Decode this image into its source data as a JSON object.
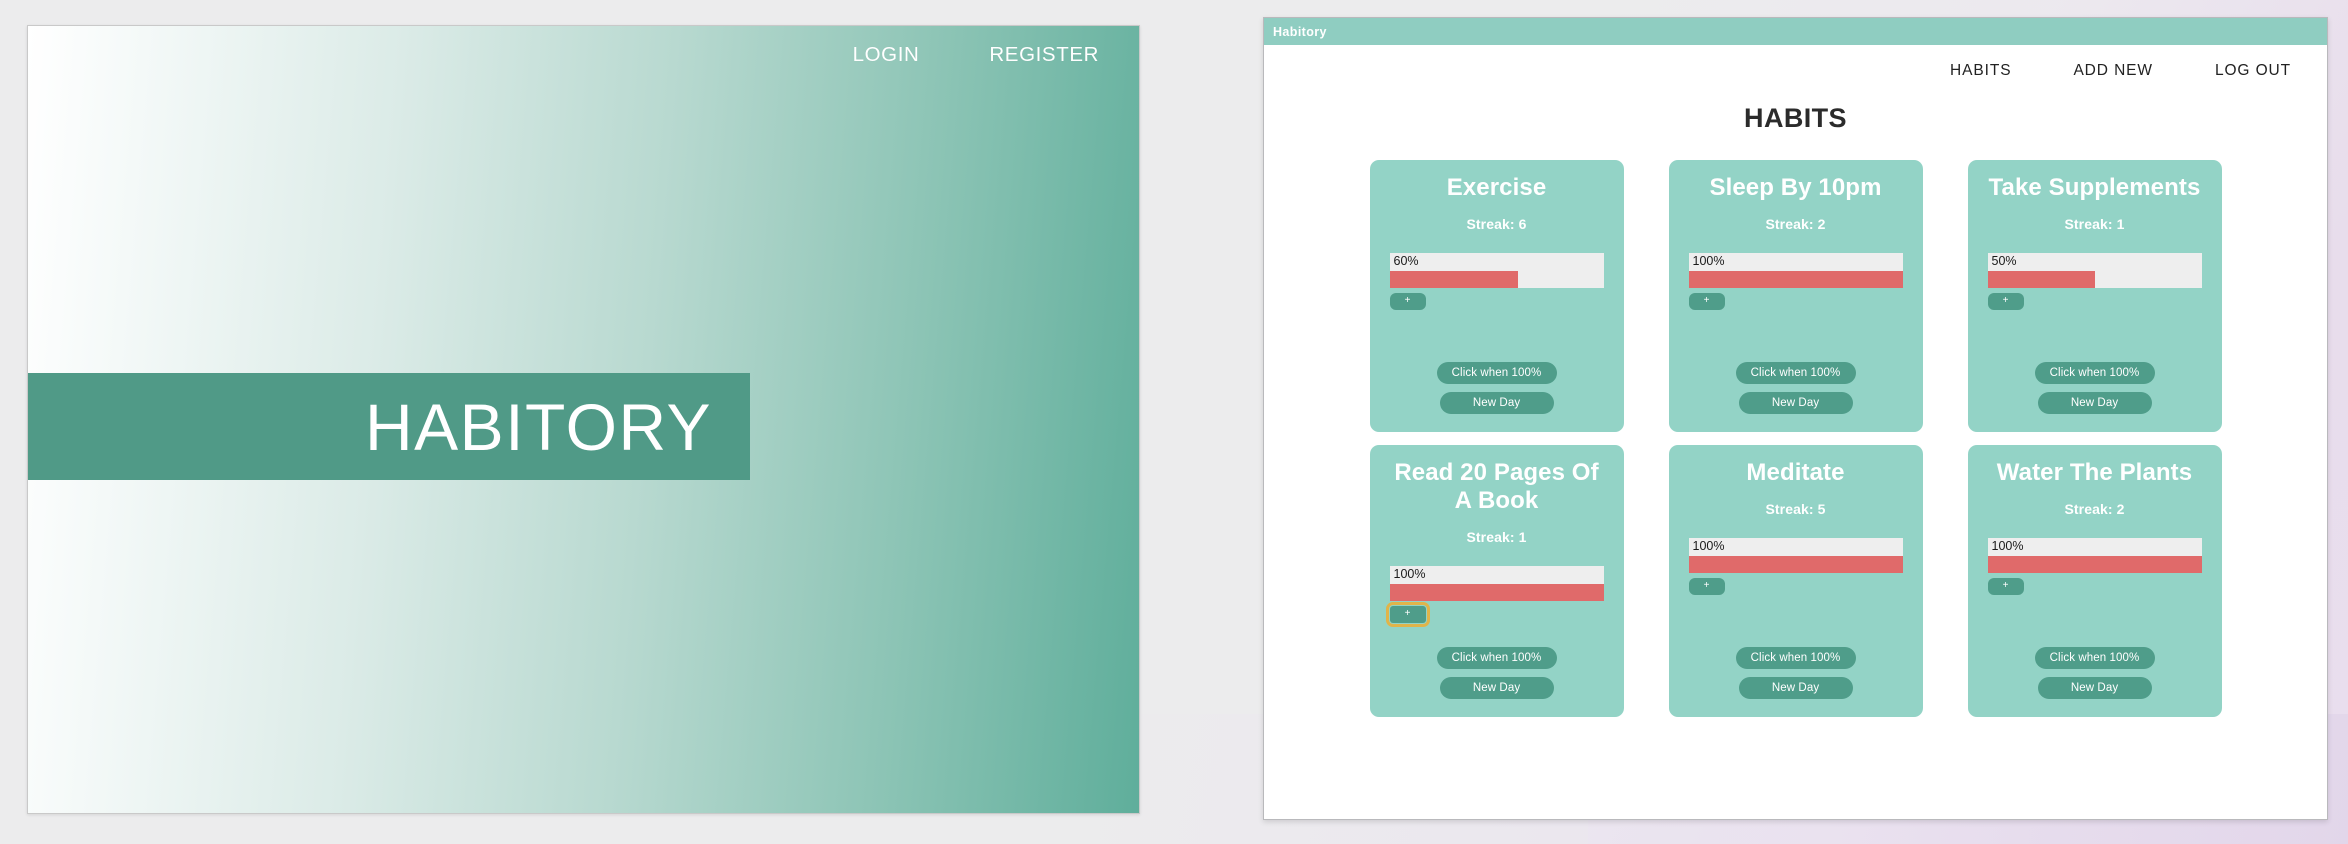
{
  "desktop": {
    "background_color": "#ececed",
    "accent_lavender": "#e8dcec"
  },
  "left_window": {
    "name": "habitory-landing-page",
    "gradient_from": "#ffffff",
    "gradient_to": "#5fae9b",
    "nav": [
      {
        "label": "LOGIN",
        "name": "login-link"
      },
      {
        "label": "REGISTER",
        "name": "register-link"
      }
    ],
    "hero": {
      "title": "HABITORY",
      "band_color": "#509a87",
      "text_color": "#ffffff"
    }
  },
  "right_window": {
    "titlebar": {
      "text": "Habitory",
      "color": "#8fcdc1"
    },
    "topnav": [
      {
        "label": "HABITS",
        "name": "nav-habits"
      },
      {
        "label": "ADD NEW",
        "name": "nav-add-new"
      },
      {
        "label": "LOG OUT",
        "name": "nav-log-out"
      }
    ],
    "page_heading": "HABITS",
    "card_color": "#93d3c6",
    "button_color": "#4f9d8a",
    "progress_fill_color": "#e06a6a",
    "progress_track_color": "#eeeeee",
    "focus_ring_color": "#e0b44a",
    "labels": {
      "plus": "+",
      "click_when_100": "Click when 100%",
      "new_day": "New Day"
    },
    "habits": [
      {
        "title": "Exercise",
        "streak": "Streak: 6",
        "percent_label": "60%",
        "percent": 60,
        "plus_focused": false
      },
      {
        "title": "Sleep By 10pm",
        "streak": "Streak: 2",
        "percent_label": "100%",
        "percent": 100,
        "plus_focused": false
      },
      {
        "title": "Take Supplements",
        "streak": "Streak: 1",
        "percent_label": "50%",
        "percent": 50,
        "plus_focused": false
      },
      {
        "title": "Read 20 Pages Of A Book",
        "streak": "Streak: 1",
        "percent_label": "100%",
        "percent": 100,
        "plus_focused": true
      },
      {
        "title": "Meditate",
        "streak": "Streak: 5",
        "percent_label": "100%",
        "percent": 100,
        "plus_focused": false
      },
      {
        "title": "Water The Plants",
        "streak": "Streak: 2",
        "percent_label": "100%",
        "percent": 100,
        "plus_focused": false
      }
    ]
  }
}
